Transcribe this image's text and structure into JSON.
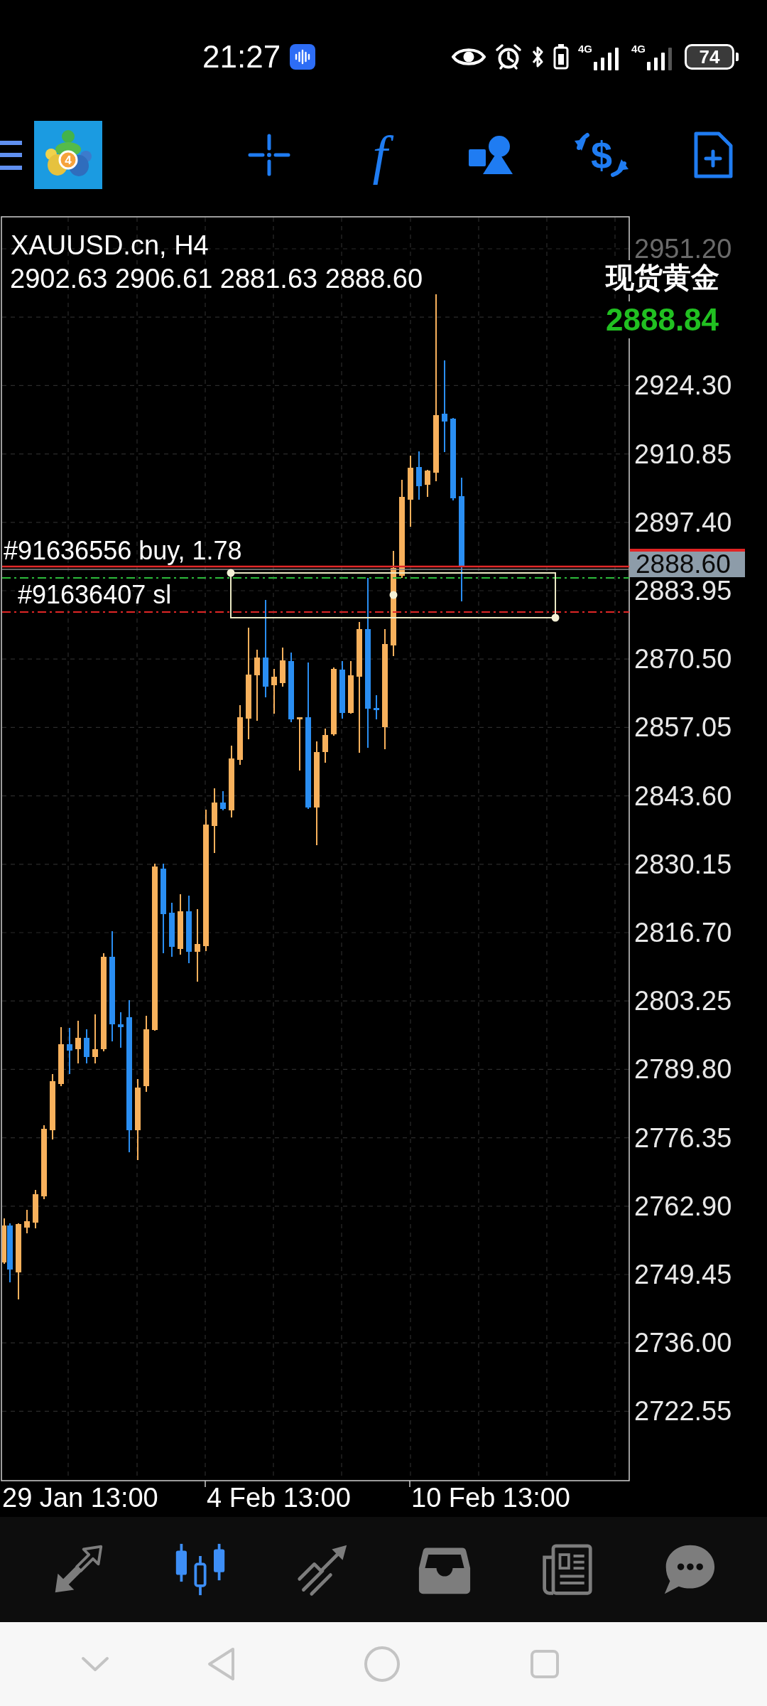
{
  "status_bar": {
    "time": "21:27",
    "network_types": [
      "4G",
      "4G"
    ],
    "battery": "74"
  },
  "toolbar": {
    "logo_badge": "4",
    "buttons": [
      {
        "kind": "crosshair"
      },
      {
        "kind": "indicators",
        "label": "f"
      },
      {
        "kind": "objects"
      },
      {
        "kind": "trade",
        "label": "$"
      },
      {
        "kind": "new_order"
      }
    ]
  },
  "chart": {
    "symbol": "XAUUSD.cn, H4",
    "ohlc": "2902.63 2906.61 2881.63 2888.60",
    "instrument": "现货黄金",
    "live_price": "2888.84",
    "price_labels": [
      {
        "text": "2951.20",
        "dimmed": true
      },
      {
        "text": "2924.30",
        "dimmed": false
      },
      {
        "text": "2910.85",
        "dimmed": false
      },
      {
        "text": "2897.40",
        "dimmed": false
      },
      {
        "text": "2883.95",
        "dimmed": false
      },
      {
        "text": "2870.50",
        "dimmed": false
      },
      {
        "text": "2857.05",
        "dimmed": false
      },
      {
        "text": "2843.60",
        "dimmed": false
      },
      {
        "text": "2830.15",
        "dimmed": false
      },
      {
        "text": "2816.70",
        "dimmed": false
      },
      {
        "text": "2803.25",
        "dimmed": false
      },
      {
        "text": "2789.80",
        "dimmed": false
      },
      {
        "text": "2776.35",
        "dimmed": false
      },
      {
        "text": "2762.90",
        "dimmed": false
      },
      {
        "text": "2749.45",
        "dimmed": false
      },
      {
        "text": "2736.00",
        "dimmed": false
      },
      {
        "text": "2722.55",
        "dimmed": false
      }
    ],
    "current_price": "2888.60",
    "orders": [
      {
        "kind": "position",
        "label": "#91636556 buy, 1.78"
      },
      {
        "kind": "stop_loss",
        "label": "#91636407 sl"
      }
    ],
    "time_labels": [
      "29 Jan 13:00",
      "4 Feb 13:00",
      "10 Feb 13:00"
    ]
  },
  "bottom_nav": [
    {
      "kind": "quotes",
      "selected": false
    },
    {
      "kind": "chart",
      "selected": true
    },
    {
      "kind": "trade",
      "selected": false
    },
    {
      "kind": "history",
      "selected": false
    },
    {
      "kind": "news",
      "selected": false
    },
    {
      "kind": "messages",
      "selected": false
    }
  ]
}
